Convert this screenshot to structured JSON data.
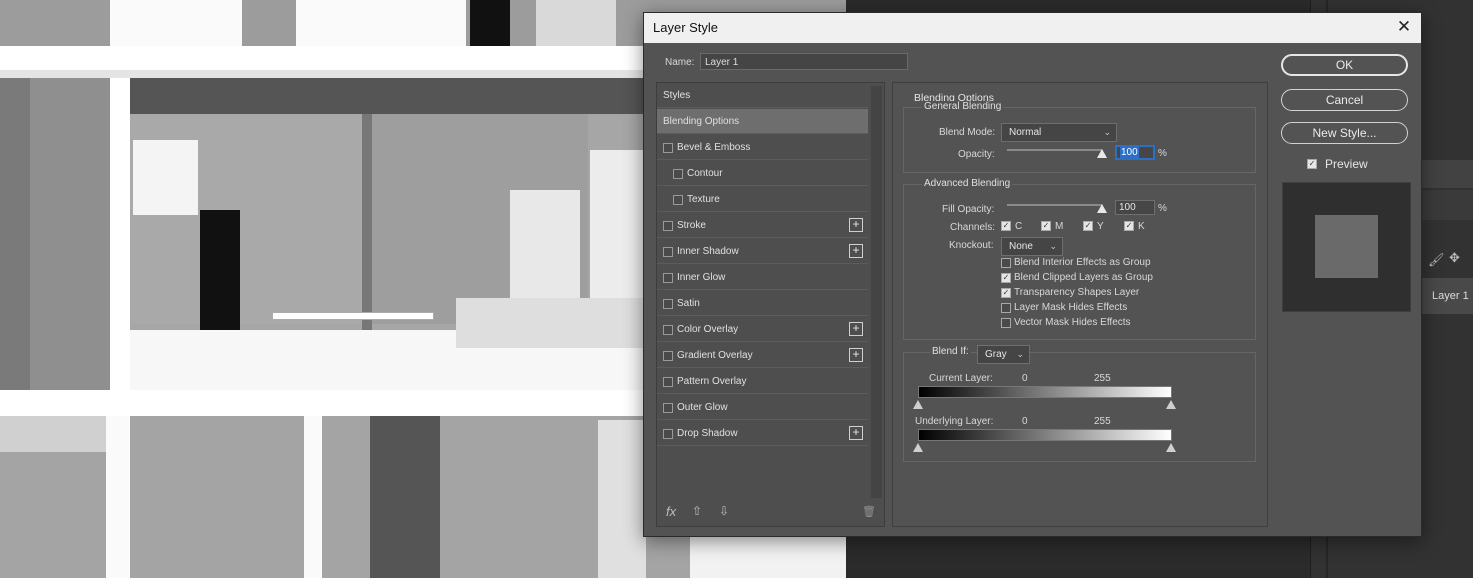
{
  "dialog": {
    "title": "Layer Style",
    "name_label": "Name:",
    "name_value": "Layer 1"
  },
  "styles": {
    "header": "Styles",
    "items": [
      {
        "label": "Blending Options",
        "selected": true
      },
      {
        "label": "Bevel & Emboss",
        "checkbox": true,
        "checked": false
      },
      {
        "label": "Contour",
        "checkbox": true,
        "checked": false,
        "indent": true
      },
      {
        "label": "Texture",
        "checkbox": true,
        "checked": false,
        "indent": true
      },
      {
        "label": "Stroke",
        "checkbox": true,
        "checked": false,
        "plus": true
      },
      {
        "label": "Inner Shadow",
        "checkbox": true,
        "checked": false,
        "plus": true
      },
      {
        "label": "Inner Glow",
        "checkbox": true,
        "checked": false
      },
      {
        "label": "Satin",
        "checkbox": true,
        "checked": false
      },
      {
        "label": "Color Overlay",
        "checkbox": true,
        "checked": false,
        "plus": true
      },
      {
        "label": "Gradient Overlay",
        "checkbox": true,
        "checked": false,
        "plus": true
      },
      {
        "label": "Pattern Overlay",
        "checkbox": true,
        "checked": false
      },
      {
        "label": "Outer Glow",
        "checkbox": true,
        "checked": false
      },
      {
        "label": "Drop Shadow",
        "checkbox": true,
        "checked": false,
        "plus": true
      }
    ],
    "footer": {
      "fx": "fx",
      "up": "⇧",
      "down": "⇩",
      "trash": "🗑"
    }
  },
  "blending": {
    "section_title": "Blending Options",
    "general": {
      "title": "General Blending",
      "blend_mode_label": "Blend Mode:",
      "blend_mode": "Normal",
      "opacity_label": "Opacity:",
      "opacity": "100",
      "percent": "%"
    },
    "advanced": {
      "title": "Advanced Blending",
      "fill_opacity_label": "Fill Opacity:",
      "fill_opacity": "100",
      "percent": "%",
      "channels_label": "Channels:",
      "channels": [
        {
          "label": "C",
          "checked": true
        },
        {
          "label": "M",
          "checked": true
        },
        {
          "label": "Y",
          "checked": true
        },
        {
          "label": "K",
          "checked": true
        }
      ],
      "knockout_label": "Knockout:",
      "knockout": "None",
      "options": [
        {
          "label": "Blend Interior Effects as Group",
          "checked": false
        },
        {
          "label": "Blend Clipped Layers as Group",
          "checked": true
        },
        {
          "label": "Transparency Shapes Layer",
          "checked": true
        },
        {
          "label": "Layer Mask Hides Effects",
          "checked": false
        },
        {
          "label": "Vector Mask Hides Effects",
          "checked": false
        }
      ]
    },
    "blend_if": {
      "label": "Blend If:",
      "value": "Gray",
      "current_layer_label": "Current Layer:",
      "current_min": "0",
      "current_max": "255",
      "underlying_layer_label": "Underlying Layer:",
      "underlying_min": "0",
      "underlying_max": "255"
    }
  },
  "buttons": {
    "ok": "OK",
    "cancel": "Cancel",
    "new_style": "New Style...",
    "preview_label": "Preview",
    "preview_checked": true
  },
  "app": {
    "layer_name": "Layer 1"
  }
}
